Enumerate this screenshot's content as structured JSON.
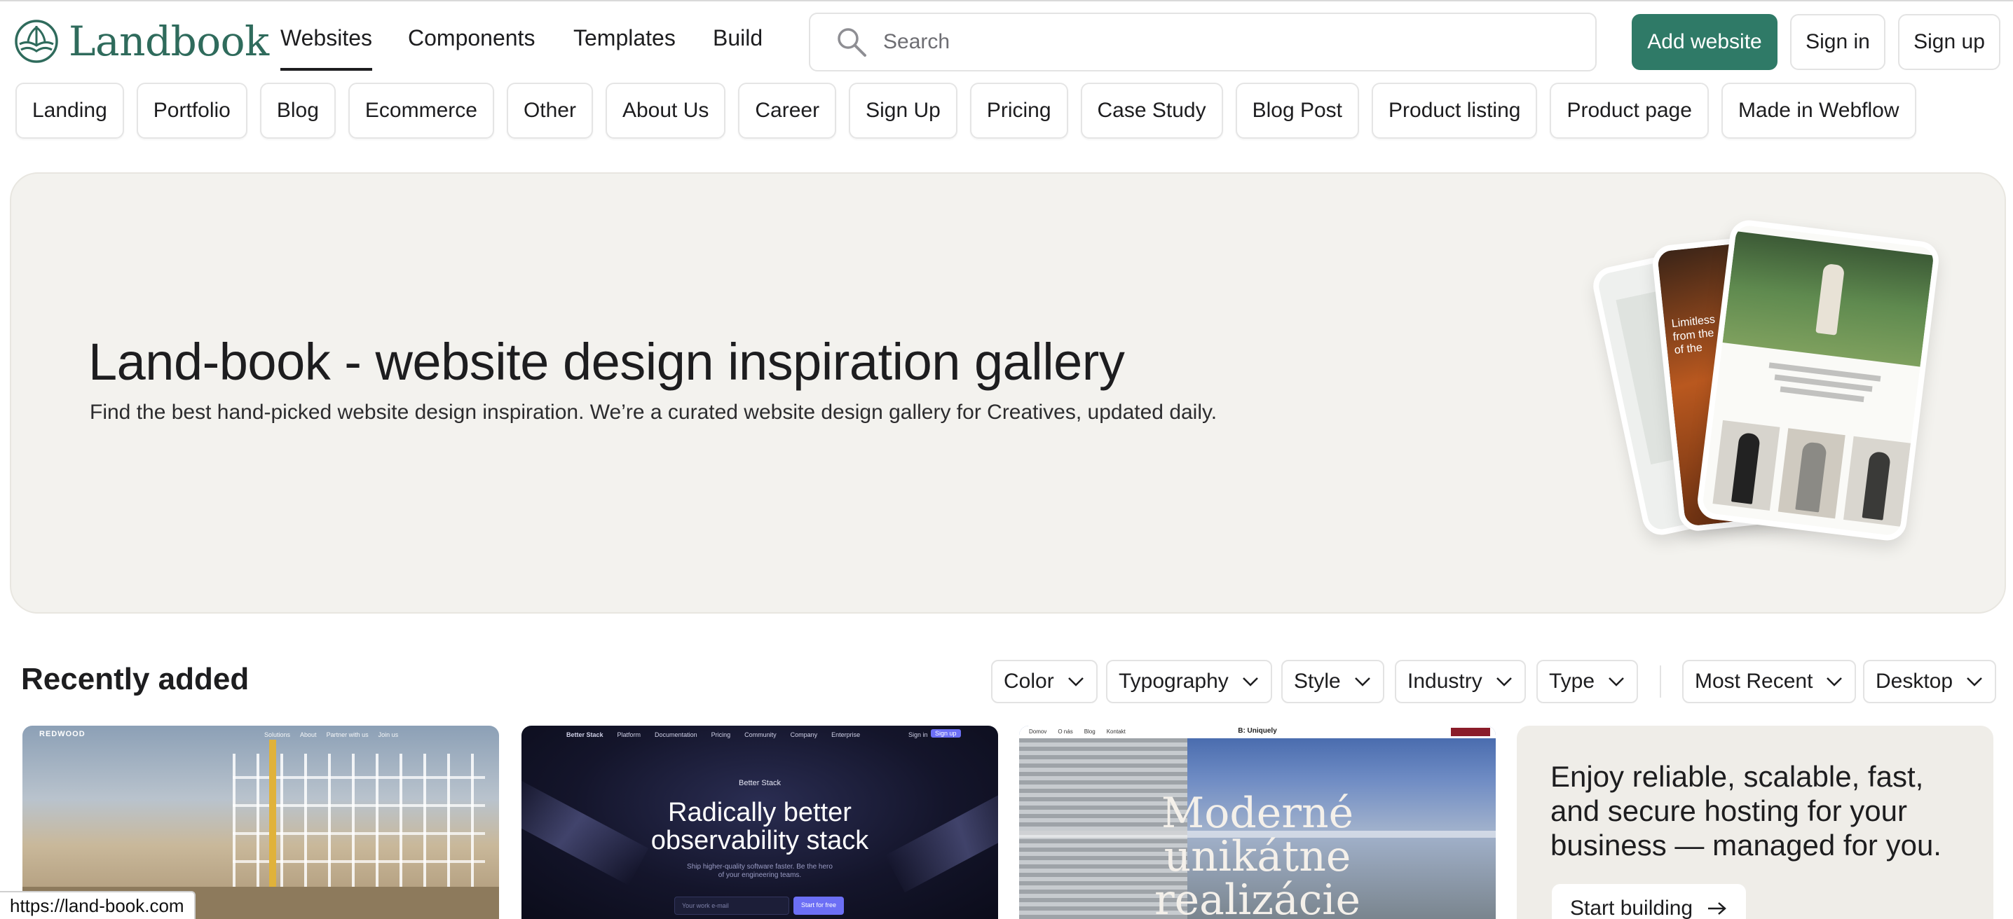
{
  "brand": {
    "name": "Landbook",
    "accent": "#2f7a67",
    "logo_color": "#2f6b5c"
  },
  "nav": {
    "items": [
      {
        "label": "Websites",
        "active": true
      },
      {
        "label": "Components",
        "active": false
      },
      {
        "label": "Templates",
        "active": false
      },
      {
        "label": "Build",
        "active": false
      }
    ]
  },
  "search": {
    "placeholder": "Search",
    "icon": "search-icon"
  },
  "actions": {
    "add_website": "Add website",
    "sign_in": "Sign in",
    "sign_up": "Sign up"
  },
  "categories": [
    "Landing",
    "Portfolio",
    "Blog",
    "Ecommerce",
    "Other",
    "About Us",
    "Career",
    "Sign Up",
    "Pricing",
    "Case Study",
    "Blog Post",
    "Product listing",
    "Product page",
    "Made in Webflow"
  ],
  "hero": {
    "title": "Land-book - website design inspiration gallery",
    "subtitle": "Find the best hand-picked website design inspiration. We’re a curated website design gallery for Creatives, updated daily.",
    "background": "#f3f2ee"
  },
  "recent": {
    "title": "Recently added",
    "filters": [
      "Color",
      "Typography",
      "Style",
      "Industry",
      "Type"
    ],
    "sort": "Most Recent",
    "device": "Desktop"
  },
  "thumbnails": {
    "t1": {
      "logo": "REDWOOD",
      "nav": [
        "Solutions",
        "About",
        "Partner with us",
        "Join us"
      ]
    },
    "t2": {
      "brand": "Better Stack",
      "nav": [
        "Platform",
        "Documentation",
        "Pricing",
        "Community",
        "Company",
        "Enterprise"
      ],
      "sign_in": "Sign in",
      "sign_up": "Sign up",
      "headline_1": "Radically better",
      "headline_2": "observability stack",
      "sub_1": "Ship higher-quality software faster. Be the hero",
      "sub_2": "of your engineering teams.",
      "placeholder": "Your work e-mail",
      "cta": "Start for free"
    },
    "t3": {
      "brand": "B: Uniquely",
      "nav": [
        "Domov",
        "O nás",
        "Blog",
        "Kontakt"
      ],
      "headline_1": "Moderné",
      "headline_2": "unikátne",
      "headline_3": "realizácie"
    }
  },
  "ad": {
    "text": "Enjoy reliable, scalable, fast, and secure hosting for your business — managed for you.",
    "cta": "Start building"
  },
  "status_url": "https://land-book.com"
}
